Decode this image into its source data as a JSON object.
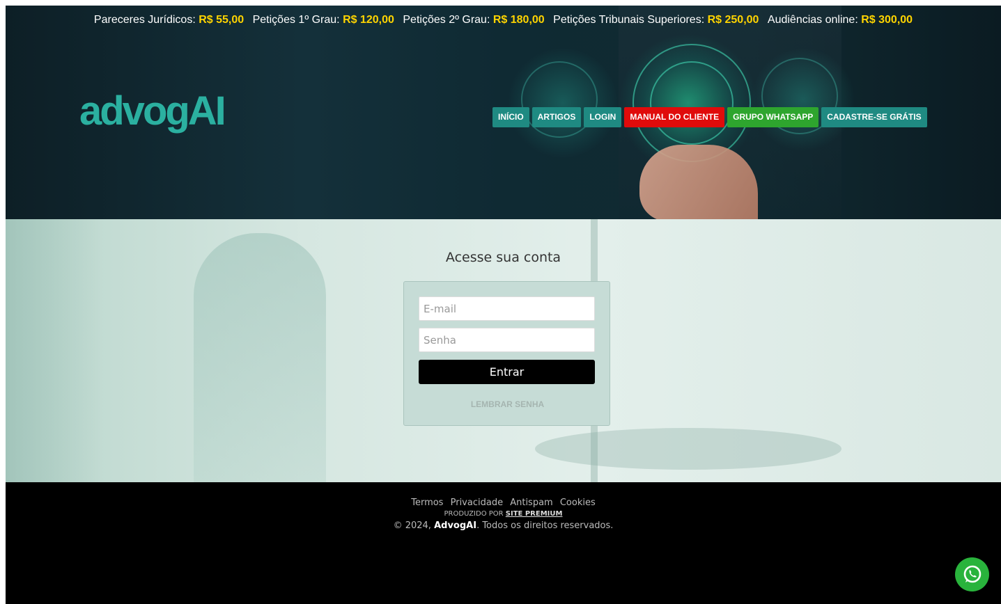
{
  "price_bar": [
    {
      "label": "Pareceres Jurídicos:",
      "price": "R$ 55,00"
    },
    {
      "label": "Petições 1º Grau:",
      "price": "R$ 120,00"
    },
    {
      "label": "Petições 2º Grau:",
      "price": "R$ 180,00"
    },
    {
      "label": "Petições Tribunais Superiores:",
      "price": "R$ 250,00"
    },
    {
      "label": "Audiências online:",
      "price": "R$ 300,00"
    }
  ],
  "logo": "advogAI",
  "nav": {
    "inicio": "INÍCIO",
    "artigos": "ARTIGOS",
    "login": "LOGIN",
    "manual": "MANUAL DO CLIENTE",
    "whatsapp": "GRUPO WHATSAPP",
    "cadastre": "CADASTRE-SE GRÁTIS"
  },
  "colors": {
    "accent": "#1f8a82",
    "manual": "#e00b0b",
    "whatsapp": "#2ea52e",
    "price_highlight": "#ffd400"
  },
  "login": {
    "title": "Acesse sua conta",
    "email_placeholder": "E-mail",
    "password_placeholder": "Senha",
    "submit": "Entrar",
    "remember": "LEMBRAR SENHA"
  },
  "footer": {
    "links": [
      "Termos",
      "Privacidade",
      "Antispam",
      "Cookies"
    ],
    "produced_by": "PRODUZIDO POR",
    "premium": "SITE PREMIUM",
    "copy_prefix": "© 2024,",
    "brand": "AdvogAI",
    "copy_suffix": ". Todos os direitos reservados."
  },
  "icons": {
    "whatsapp": "whatsapp-icon"
  }
}
